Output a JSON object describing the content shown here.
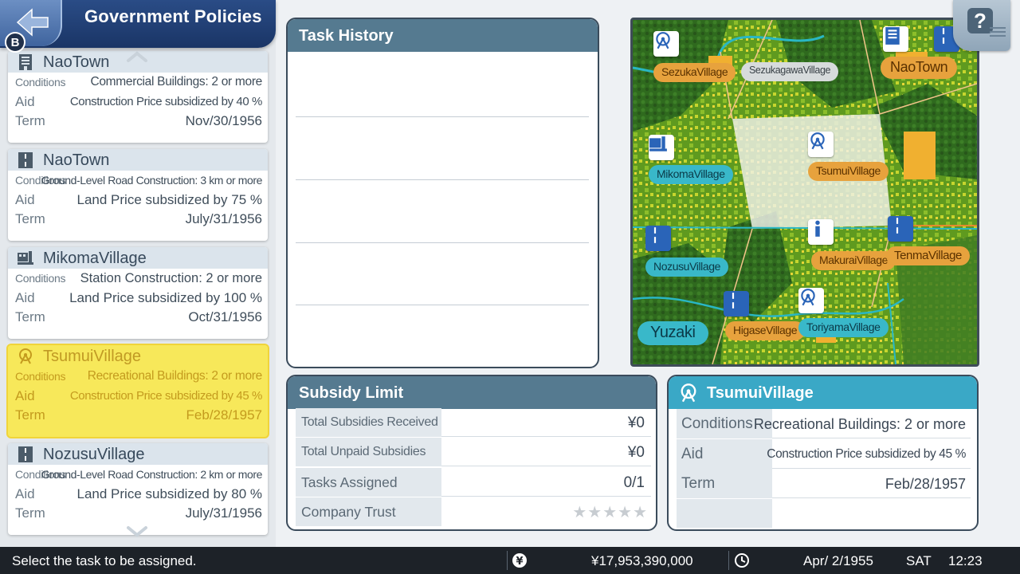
{
  "header": {
    "title": "Government Policies",
    "back_badge": "B"
  },
  "policies": [
    {
      "town": "NaoTown",
      "icon": "office-building-icon",
      "conditions_label": "Conditions",
      "conditions": "Commercial Buildings: 2 or more",
      "aid_label": "Aid",
      "aid": "Construction Price subsidized by 40 %",
      "term_label": "Term",
      "term": "Nov/30/1956"
    },
    {
      "town": "NaoTown",
      "icon": "road-icon",
      "conditions_label": "Conditions",
      "conditions": "Ground-Level Road Construction: 3 km or more",
      "aid_label": "Aid",
      "aid": "Land Price subsidized by 75 %",
      "term_label": "Term",
      "term": "July/31/1956"
    },
    {
      "town": "MikomaVillage",
      "icon": "station-icon",
      "conditions_label": "Conditions",
      "conditions": "Station Construction: 2 or more",
      "aid_label": "Aid",
      "aid": "Land Price subsidized by 100 %",
      "term_label": "Term",
      "term": "Oct/31/1956"
    },
    {
      "town": "TsumuiVillage",
      "icon": "ferris-wheel-icon",
      "conditions_label": "Conditions",
      "conditions": "Recreational Buildings: 2 or more",
      "aid_label": "Aid",
      "aid": "Construction Price subsidized by 45 %",
      "term_label": "Term",
      "term": "Feb/28/1957",
      "selected": true
    },
    {
      "town": "NozusuVillage",
      "icon": "road-icon",
      "conditions_label": "Conditions",
      "conditions": "Ground-Level Road Construction: 2 km or more",
      "aid_label": "Aid",
      "aid": "Land Price subsidized by 80 %",
      "term_label": "Term",
      "term": "July/31/1956"
    }
  ],
  "task_history": {
    "title": "Task History"
  },
  "subsidy_limit": {
    "title": "Subsidy Limit",
    "rows": [
      {
        "label": "Total Subsidies Received",
        "value": "¥0"
      },
      {
        "label": "Total Unpaid Subsidies",
        "value": "¥0"
      },
      {
        "label": "Tasks Assigned",
        "value": "0/1"
      },
      {
        "label": "Company Trust",
        "value": "★★★★★"
      }
    ]
  },
  "detail": {
    "town": "TsumuiVillage",
    "rows": [
      {
        "label": "Conditions",
        "value": "Recreational Buildings: 2 or more"
      },
      {
        "label": "Aid",
        "value": "Construction Price subsidized by 45 %"
      },
      {
        "label": "Term",
        "value": "Feb/28/1957"
      }
    ]
  },
  "map": {
    "labels": {
      "sezuka": "SezukaVillage",
      "sezukagawa": "SezukagawaVillage",
      "nao": "NaoTown",
      "mikoma": "MikomaVillage",
      "tsumui": "TsumuiVillage",
      "nozusu": "NozusuVillage",
      "makurai": "MakuraiVillage",
      "tenma": "TenmaVillage",
      "yuzaki": "Yuzaki",
      "higase": "HigaseVillage",
      "toriyama": "ToriyamaVillage"
    }
  },
  "help": {
    "label": "?"
  },
  "status": {
    "message": "Select the task to be assigned.",
    "money": "¥17,953,390,000",
    "date": "Apr/ 2/1955",
    "weekday": "SAT",
    "time": "12:23"
  },
  "colors": {
    "header_blue": "#1f3b70",
    "selected_yellow": "#f7e85a",
    "title_teal": "#3aa8c6",
    "title_slate": "#557a90"
  }
}
